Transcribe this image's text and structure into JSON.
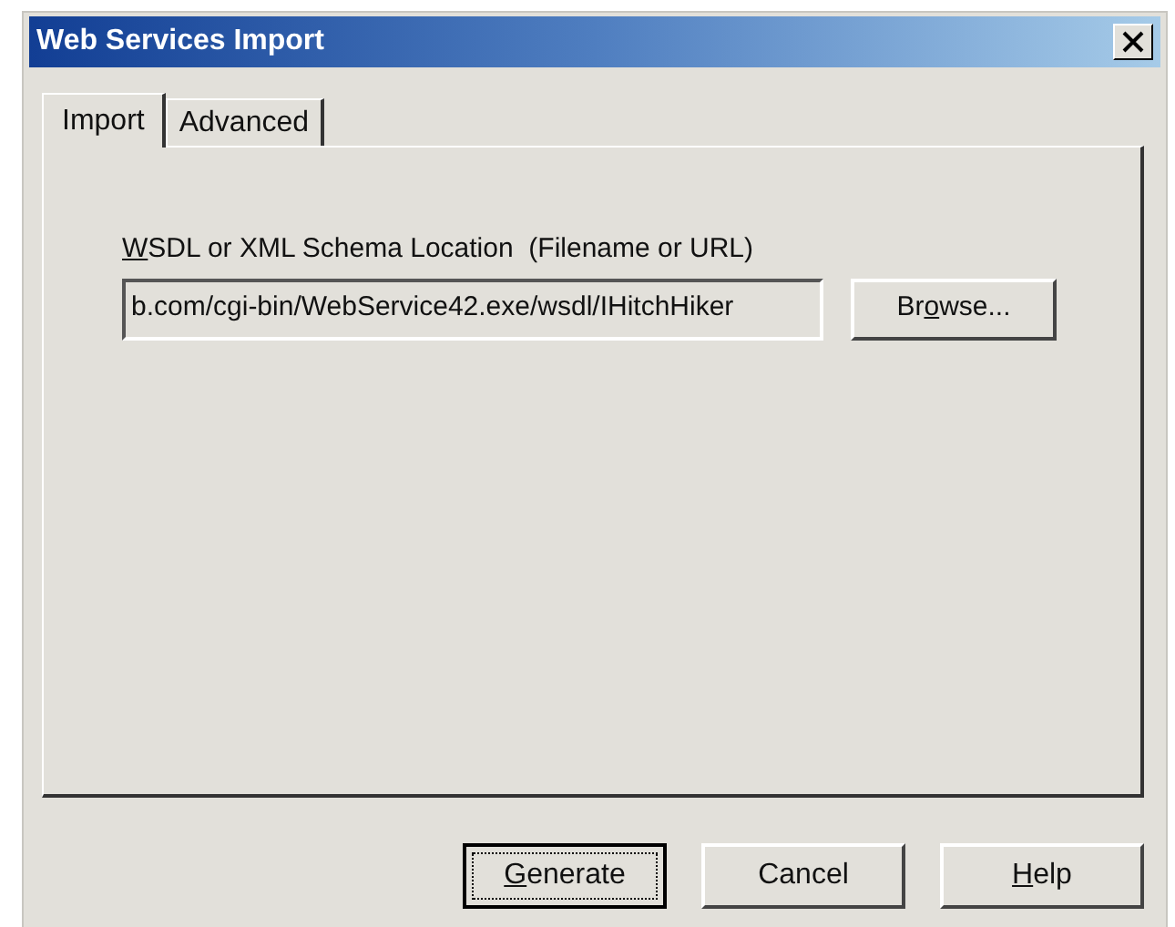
{
  "window": {
    "title": "Web Services Import"
  },
  "tabs": [
    {
      "label": "Import",
      "selected": true
    },
    {
      "label": "Advanced",
      "selected": false
    }
  ],
  "location": {
    "label": {
      "key": "W",
      "after": "SDL or XML Schema Location  (Filename or URL)"
    },
    "value": "b.com/cgi-bin/WebService42.exe/wsdl/IHitchHiker",
    "browse": {
      "before": "Br",
      "key": "o",
      "after": "wse..."
    }
  },
  "buttons": [
    {
      "key": "G",
      "after": "enerate",
      "default": true
    },
    {
      "label": "Cancel",
      "default": false
    },
    {
      "key": "H",
      "after": "elp",
      "default": false
    }
  ]
}
